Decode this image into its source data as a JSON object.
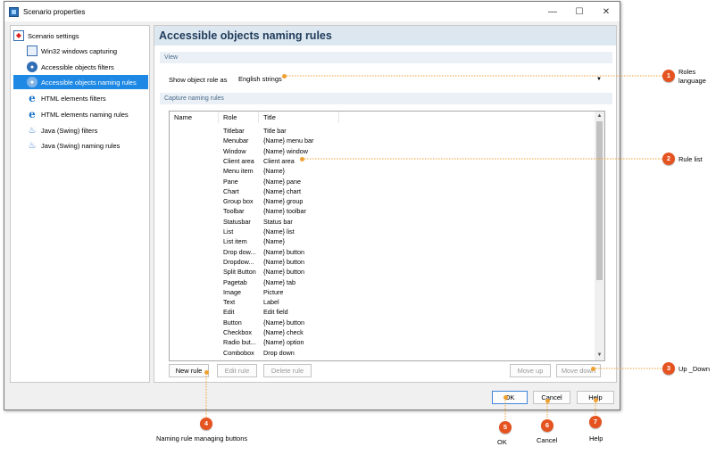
{
  "window": {
    "title": "Scenario properties",
    "minimize_glyph": "—",
    "maximize_glyph": "☐",
    "close_glyph": "✕"
  },
  "sidebar": {
    "items": [
      {
        "label": "Scenario settings",
        "icon": "settings-icon"
      },
      {
        "label": "Win32 windows capturing",
        "icon": "window-icon"
      },
      {
        "label": "Accessible objects filters",
        "icon": "accessibility-icon"
      },
      {
        "label": "Accessible objects naming rules",
        "icon": "accessibility-icon",
        "selected": true
      },
      {
        "label": "HTML elements filters",
        "icon": "ie-icon"
      },
      {
        "label": "HTML elements naming rules",
        "icon": "ie-icon"
      },
      {
        "label": "Java (Swing) filters",
        "icon": "java-icon"
      },
      {
        "label": "Java (Swing) naming rules",
        "icon": "java-icon"
      }
    ]
  },
  "main": {
    "title": "Accessible objects naming rules",
    "view_section": "View",
    "show_role_label": "Show object role as",
    "role_select_value": "English strings",
    "capture_section": "Capture naming rules",
    "columns": [
      "Name",
      "Role",
      "Title"
    ],
    "rows": [
      {
        "name": "",
        "role": "Titlebar",
        "title": "Title bar"
      },
      {
        "name": "",
        "role": "Menubar",
        "title": "{Name} menu bar"
      },
      {
        "name": "",
        "role": "Window",
        "title": "{Name} window"
      },
      {
        "name": "",
        "role": "Client area",
        "title": "Client area"
      },
      {
        "name": "",
        "role": "Menu item",
        "title": "{Name}"
      },
      {
        "name": "",
        "role": "Pane",
        "title": "{Name} pane"
      },
      {
        "name": "",
        "role": "Chart",
        "title": "{Name} chart"
      },
      {
        "name": "",
        "role": "Group box",
        "title": "{Name} group"
      },
      {
        "name": "",
        "role": "Toolbar",
        "title": "{Name} toolbar"
      },
      {
        "name": "",
        "role": "Statusbar",
        "title": "Status bar"
      },
      {
        "name": "",
        "role": "List",
        "title": "{Name} list"
      },
      {
        "name": "",
        "role": "List item",
        "title": "{Name}"
      },
      {
        "name": "",
        "role": "Drop dow...",
        "title": "{Name} button"
      },
      {
        "name": "",
        "role": "Dropdow...",
        "title": "{Name} button"
      },
      {
        "name": "",
        "role": "Split Button",
        "title": "{Name} button"
      },
      {
        "name": "",
        "role": "Pagetab",
        "title": "{Name} tab"
      },
      {
        "name": "",
        "role": "Image",
        "title": "Picture"
      },
      {
        "name": "",
        "role": "Text",
        "title": "Label"
      },
      {
        "name": "",
        "role": "Edit",
        "title": "Edit field"
      },
      {
        "name": "",
        "role": "Button",
        "title": "{Name} button"
      },
      {
        "name": "",
        "role": "Checkbox",
        "title": "{Name} check"
      },
      {
        "name": "",
        "role": "Radio but...",
        "title": "{Name} option"
      },
      {
        "name": "",
        "role": "Combobox",
        "title": "Drop down"
      }
    ],
    "buttons": {
      "new_rule": "New rule",
      "edit_rule": "Edit rule",
      "delete_rule": "Delete rule",
      "move_up": "Move up",
      "move_down": "Move down"
    }
  },
  "footer": {
    "ok": "OK",
    "cancel": "Cancel",
    "help": "Help"
  },
  "callouts": [
    {
      "number": "1",
      "label": "Roles\nlanguage"
    },
    {
      "number": "2",
      "label": "Rule list"
    },
    {
      "number": "3",
      "label": "Up _Down"
    },
    {
      "number": "4",
      "label": "Naming rule managing buttons"
    },
    {
      "number": "5",
      "label": "OK"
    },
    {
      "number": "6",
      "label": "Cancel"
    },
    {
      "number": "7",
      "label": "Help"
    }
  ],
  "colors": {
    "selection": "#1e88e5",
    "callout": "#e55320",
    "leader": "#f0a030",
    "title_band": "#dde7f0"
  }
}
